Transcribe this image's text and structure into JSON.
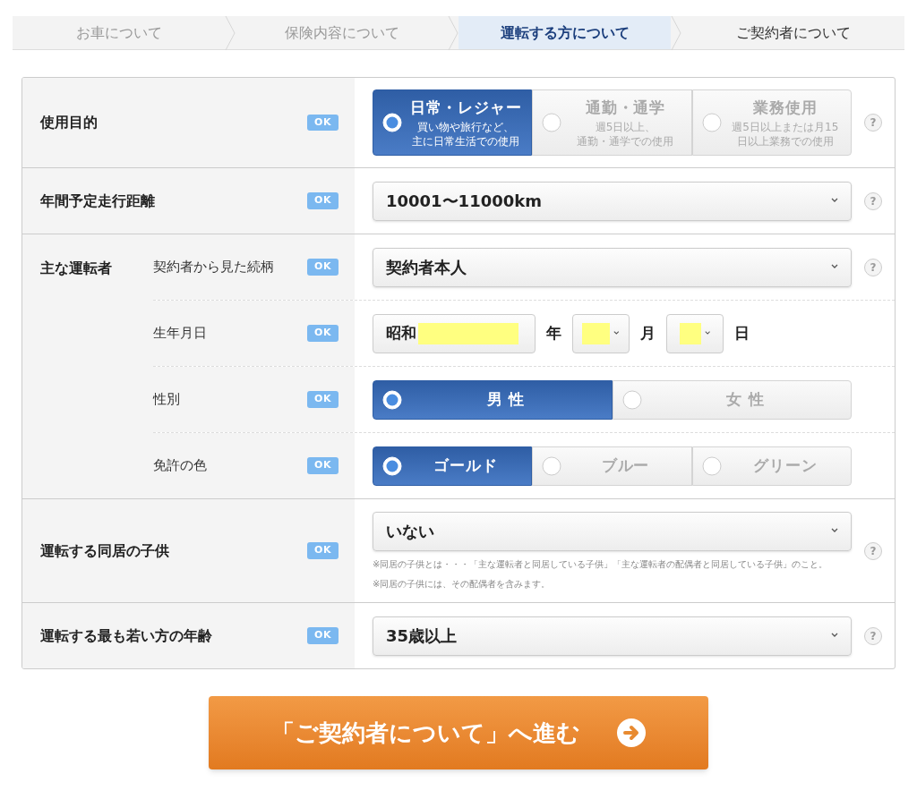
{
  "steps": [
    {
      "label": "お車について",
      "done": true,
      "selected": false
    },
    {
      "label": "保険内容について",
      "done": true,
      "selected": false
    },
    {
      "label": "運転する方について",
      "done": false,
      "selected": true
    },
    {
      "label": "ご契約者について",
      "done": false,
      "selected": false
    }
  ],
  "rows": [
    {
      "label": "使用目的",
      "status": "OK",
      "kind": "radio",
      "help": "?",
      "options": [
        {
          "title": "日常・レジャー",
          "note": [
            "買い物や旅行など、",
            "主に日常生活での使用"
          ],
          "selected": true
        },
        {
          "title": "通勤・通学",
          "note": [
            "週5日以上、",
            "通勤・通学での使用"
          ],
          "selected": false
        },
        {
          "title": "業務使用",
          "note": [
            "週5日以上または月15",
            "日以上業務での使用"
          ],
          "selected": false
        }
      ]
    },
    {
      "label": "年間予定走行距離",
      "status": "OK",
      "kind": "select",
      "help": "?",
      "value": "10001〜11000km"
    },
    {
      "label": "主な運転者",
      "kind": "group",
      "subrows": [
        {
          "label": "契約者から見た続柄",
          "status": "OK",
          "kind": "select",
          "help": "?",
          "value": "契約者本人"
        },
        {
          "label": "生年月日",
          "status": "OK",
          "kind": "date",
          "era": "昭和",
          "units": [
            "年",
            "月",
            "日"
          ]
        },
        {
          "label": "性別",
          "status": "OK",
          "kind": "radio",
          "options": [
            {
              "title": "男 性",
              "selected": true
            },
            {
              "title": "女 性",
              "selected": false
            }
          ]
        },
        {
          "label": "免許の色",
          "status": "OK",
          "kind": "radio",
          "options": [
            {
              "title": "ゴールド",
              "selected": true
            },
            {
              "title": "ブルー",
              "selected": false
            },
            {
              "title": "グリーン",
              "selected": false
            }
          ]
        }
      ]
    },
    {
      "label": "運転する同居の子供",
      "status": "OK",
      "kind": "select",
      "help": "?",
      "value": "いない",
      "notes": [
        "※同居の子供とは・・・「主な運転者と同居している子供」「主な運転者の配偶者と同居している子供」のこと。",
        "※同居の子供には、その配偶者を含みます。"
      ]
    },
    {
      "label": "運転する最も若い方の年齢",
      "status": "OK",
      "kind": "select",
      "help": "?",
      "value": "35歳以上"
    }
  ],
  "next_button": "「ご契約者について」へ進む"
}
